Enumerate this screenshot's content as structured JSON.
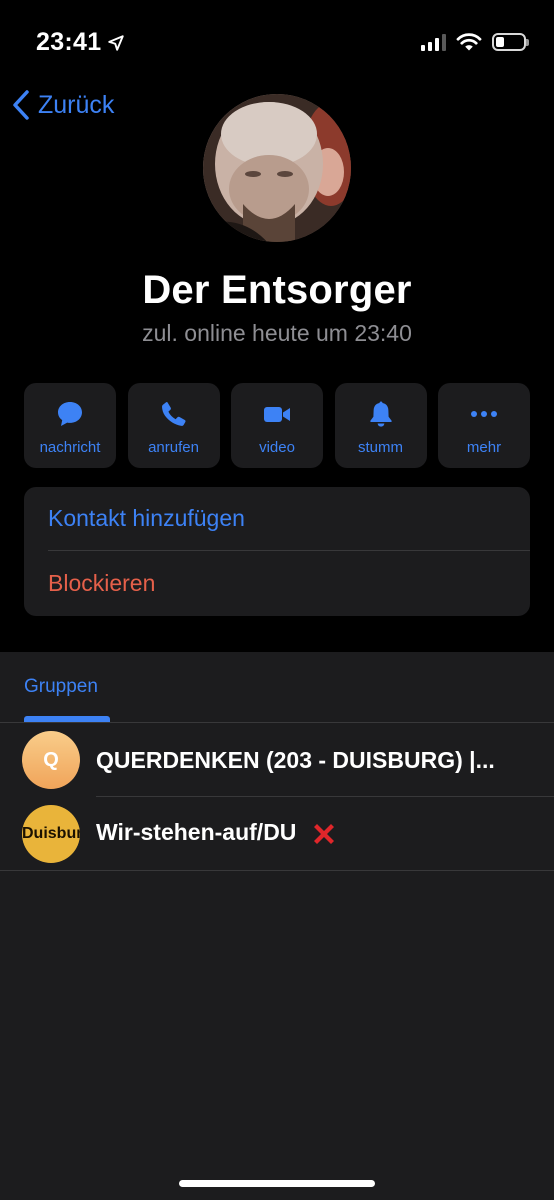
{
  "status_bar": {
    "time": "23:41",
    "icons": [
      "location-arrow-icon",
      "cellular-signal-icon",
      "wifi-icon",
      "battery-icon"
    ]
  },
  "nav": {
    "back_label": "Zurück"
  },
  "profile": {
    "name": "Der Entsorger",
    "status": "zul. online heute um 23:40"
  },
  "actions": [
    {
      "label": "nachricht",
      "icon": "chat-bubble-icon"
    },
    {
      "label": "anrufen",
      "icon": "phone-icon"
    },
    {
      "label": "video",
      "icon": "video-camera-icon"
    },
    {
      "label": "stumm",
      "icon": "bell-icon"
    },
    {
      "label": "mehr",
      "icon": "ellipsis-icon"
    }
  ],
  "options": {
    "add_contact": "Kontakt hinzufügen",
    "block": "Blockieren"
  },
  "groups": {
    "tab_label": "Gruppen",
    "items": [
      {
        "avatar_text": "Q",
        "name": "QUERDENKEN (203 - DUISBURG) |..."
      },
      {
        "avatar_text": "Duisbur",
        "name": "Wir-stehen-auf/DU"
      }
    ]
  },
  "colors": {
    "accent": "#3d82f5",
    "destructive": "#e5604a",
    "background": "#000000",
    "card": "#1c1c1e",
    "secondary_text": "#8e8e93"
  }
}
